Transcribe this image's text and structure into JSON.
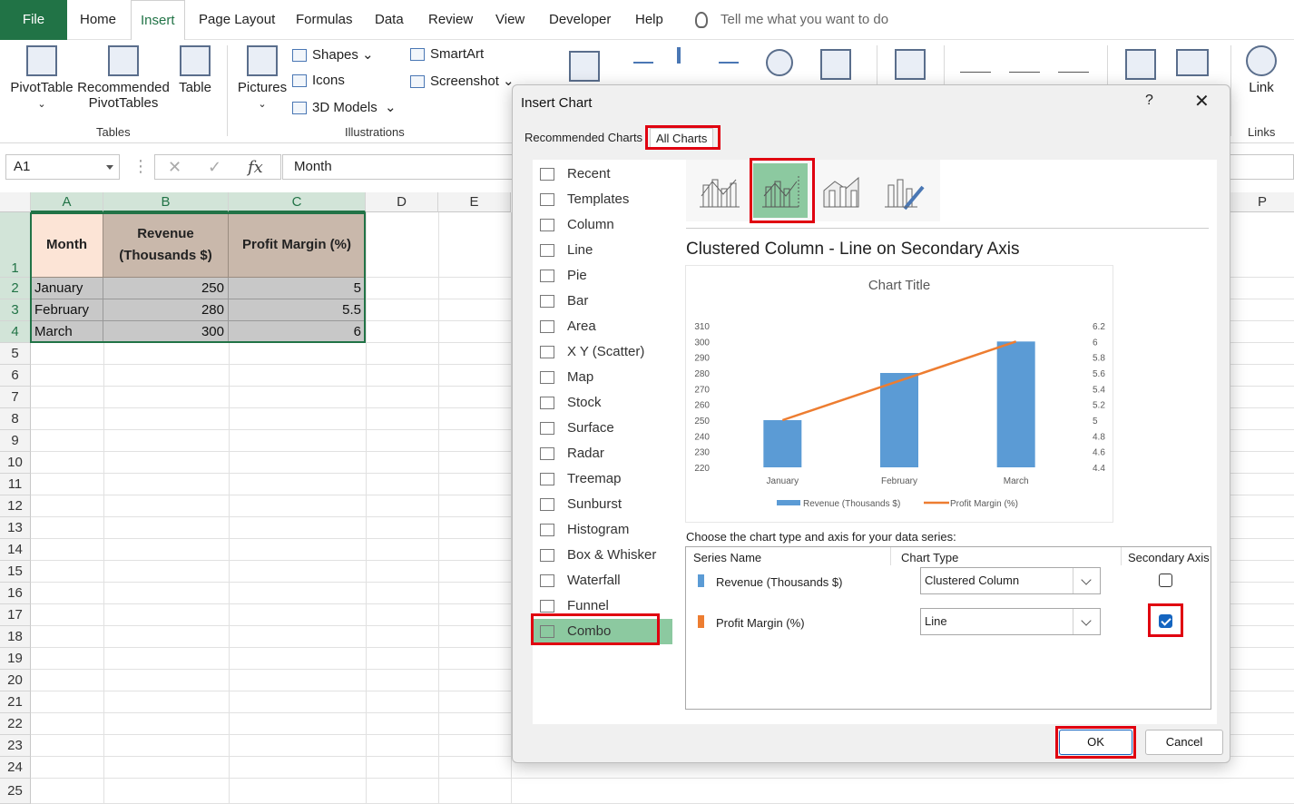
{
  "ribbon_tabs": {
    "file": "File",
    "home": "Home",
    "insert": "Insert",
    "page_layout": "Page Layout",
    "formulas": "Formulas",
    "data": "Data",
    "review": "Review",
    "view": "View",
    "developer": "Developer",
    "help": "Help",
    "tell_me": "Tell me what you want to do"
  },
  "ribbon": {
    "pivottable": "PivotTable",
    "recommended_pt_1": "Recommended",
    "recommended_pt_2": "PivotTables",
    "table": "Table",
    "pictures": "Pictures",
    "shapes": "Shapes",
    "icons": "Icons",
    "models3d": "3D Models",
    "smartart": "SmartArt",
    "screenshot": "Screenshot",
    "link": "Link",
    "group_tables": "Tables",
    "group_illustrations": "Illustrations",
    "group_links": "Links"
  },
  "formula_bar": {
    "name_box": "A1",
    "fx": "fx",
    "value": "Month"
  },
  "sheet": {
    "columns": [
      "A",
      "B",
      "C",
      "D",
      "E",
      "P"
    ],
    "rows": [
      "1",
      "2",
      "3",
      "4",
      "5",
      "6",
      "7",
      "8",
      "9",
      "10",
      "11",
      "12",
      "13",
      "14",
      "15",
      "16",
      "17",
      "18",
      "19",
      "20",
      "21",
      "22",
      "23",
      "24",
      "25"
    ],
    "header": {
      "month": "Month",
      "revenue_1": "Revenue",
      "revenue_2": "(Thousands $)",
      "margin": "Profit Margin (%)"
    },
    "data": [
      {
        "month": "January",
        "revenue": "250",
        "margin": "5"
      },
      {
        "month": "February",
        "revenue": "280",
        "margin": "5.5"
      },
      {
        "month": "March",
        "revenue": "300",
        "margin": "6"
      }
    ],
    "colors": {
      "month_header": "#fce4d6",
      "other_header": "#c9b8ab",
      "data_fill": "#c8c8c8",
      "selection": "#217346"
    }
  },
  "dialog": {
    "title": "Insert Chart",
    "help": "?",
    "close": "✕",
    "tab_recommended": "Recommended Charts",
    "tab_all": "All Charts",
    "chart_types": [
      "Recent",
      "Templates",
      "Column",
      "Line",
      "Pie",
      "Bar",
      "Area",
      "X Y (Scatter)",
      "Map",
      "Stock",
      "Surface",
      "Radar",
      "Treemap",
      "Sunburst",
      "Histogram",
      "Box & Whisker",
      "Waterfall",
      "Funnel",
      "Combo"
    ],
    "selected_type": "Combo",
    "subtype_title": "Clustered Column - Line on Secondary Axis",
    "choose_label": "Choose the chart type and axis for your data series:",
    "table_headers": {
      "series_name": "Series Name",
      "chart_type": "Chart Type",
      "secondary_axis": "Secondary Axis"
    },
    "series": [
      {
        "name": "Revenue (Thousands $)",
        "type": "Clustered Column",
        "secondary": false,
        "color": "#5b9bd5"
      },
      {
        "name": "Profit Margin (%)",
        "type": "Line",
        "secondary": true,
        "color": "#ed7d31"
      }
    ],
    "ok": "OK",
    "cancel": "Cancel",
    "highlight_color": "#e00010",
    "selected_fill": "#8cc9a0"
  },
  "chart_data": {
    "type": "bar",
    "title": "Chart Title",
    "categories": [
      "January",
      "February",
      "March"
    ],
    "series": [
      {
        "name": "Revenue (Thousands $)",
        "type": "bar",
        "axis": "primary",
        "values": [
          250,
          280,
          300
        ],
        "color": "#5b9bd5"
      },
      {
        "name": "Profit Margin (%)",
        "type": "line",
        "axis": "secondary",
        "values": [
          5,
          5.5,
          6
        ],
        "color": "#ed7d31"
      }
    ],
    "ylim": [
      220,
      310
    ],
    "yticks": [
      "310",
      "300",
      "290",
      "280",
      "270",
      "260",
      "250",
      "240",
      "230",
      "220"
    ],
    "y2lim": [
      4.4,
      6.2
    ],
    "y2ticks": [
      "6.2",
      "6",
      "5.8",
      "5.6",
      "5.4",
      "5.2",
      "5",
      "4.8",
      "4.6",
      "4.4"
    ],
    "legend": "bottom",
    "grid": false
  }
}
